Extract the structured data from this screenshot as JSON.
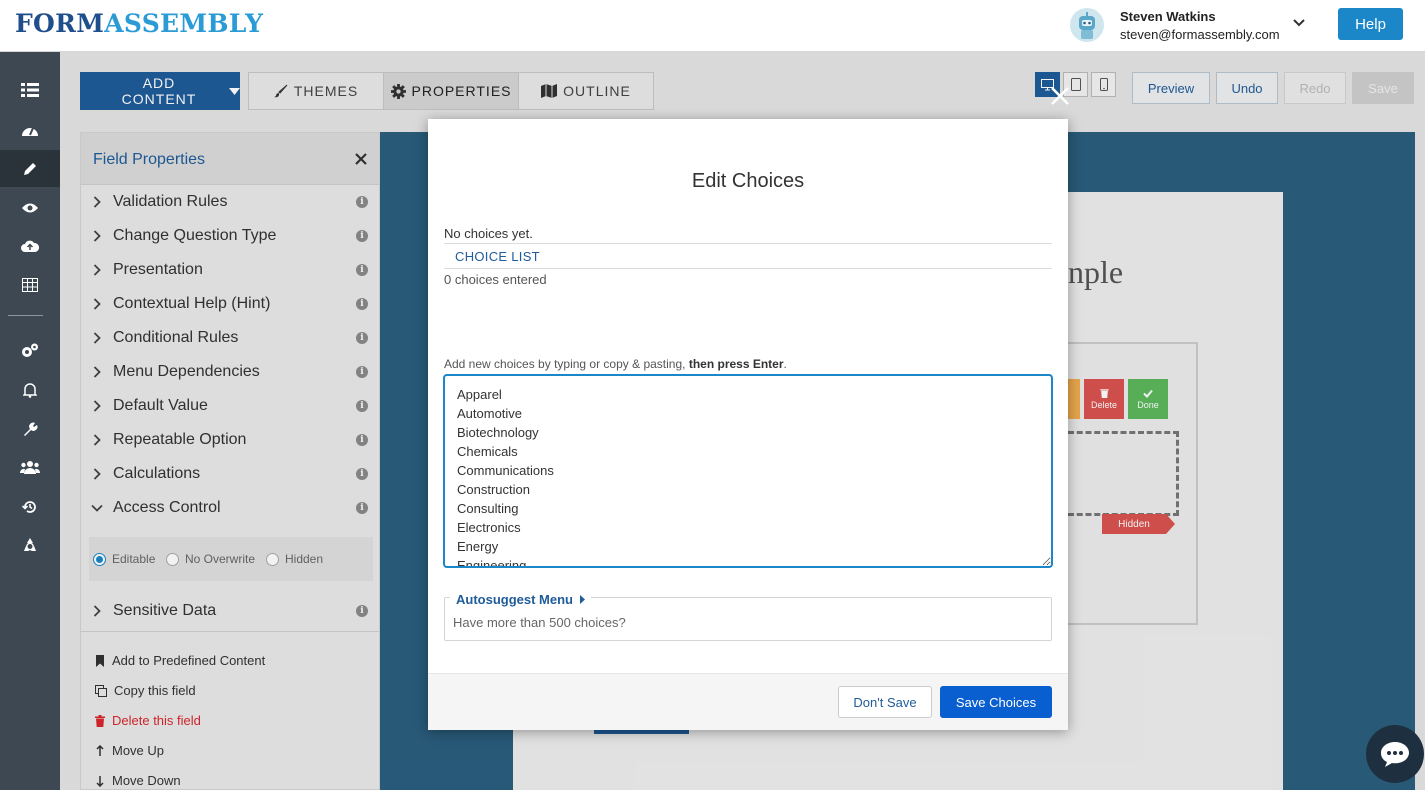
{
  "header": {
    "logo_part1": "FORM",
    "logo_part2": "ASSEMBLY",
    "user_name": "Steven Watkins",
    "user_email": "steven@formassembly.com",
    "help_label": "Help"
  },
  "leftnav": {
    "icons": [
      "list-icon",
      "dashboard-icon",
      "pencil-icon",
      "eye-icon",
      "cloud-upload-icon",
      "table-icon",
      "gears-icon",
      "bell-icon",
      "wrench-icon",
      "users-icon",
      "history-icon",
      "recycle-icon"
    ],
    "active_item": "pencil-icon"
  },
  "toolbar": {
    "add_content_label": "ADD CONTENT",
    "tabs": [
      {
        "label": "THEMES",
        "icon": "brush-icon"
      },
      {
        "label": "PROPERTIES",
        "icon": "gear-icon"
      },
      {
        "label": "OUTLINE",
        "icon": "map-icon"
      }
    ],
    "active_tab": "PROPERTIES",
    "preview_label": "Preview",
    "undo_label": "Undo",
    "redo_label": "Redo",
    "save_label": "Save"
  },
  "field_properties": {
    "title": "Field Properties",
    "sections": [
      "Validation Rules",
      "Change Question Type",
      "Presentation",
      "Contextual Help (Hint)",
      "Conditional Rules",
      "Menu Dependencies",
      "Default Value",
      "Repeatable Option",
      "Calculations",
      "Access Control",
      "Sensitive Data"
    ],
    "expanded_section": "Access Control",
    "access_options": [
      "Editable",
      "No Overwrite",
      "Hidden"
    ],
    "access_selected": "Editable",
    "actions": {
      "predefined": "Add to Predefined Content",
      "copy": "Copy this field",
      "delete": "Delete this field",
      "move_up": "Move Up",
      "move_down": "Move Down"
    }
  },
  "canvas": {
    "title_fragment": "nple",
    "delete_label": "Delete",
    "done_label": "Done",
    "hidden_tag": "Hidden"
  },
  "modal": {
    "title": "Edit Choices",
    "no_choices": "No choices yet.",
    "choice_list_tab": "CHOICE LIST",
    "count_text": "0 choices entered",
    "hint_prefix": "Add new choices by typing or copy & pasting,",
    "hint_bold": "then press Enter",
    "hint_suffix": ".",
    "choices_text": "Apparel\nAutomotive\nBiotechnology\nChemicals\nCommunications\nConstruction\nConsulting\nElectronics\nEnergy\nEngineering",
    "autosuggest_label": "Autosuggest Menu",
    "autosuggest_text": "Have more than 500 choices?",
    "dont_save_label": "Don't Save",
    "save_choices_label": "Save Choices"
  }
}
